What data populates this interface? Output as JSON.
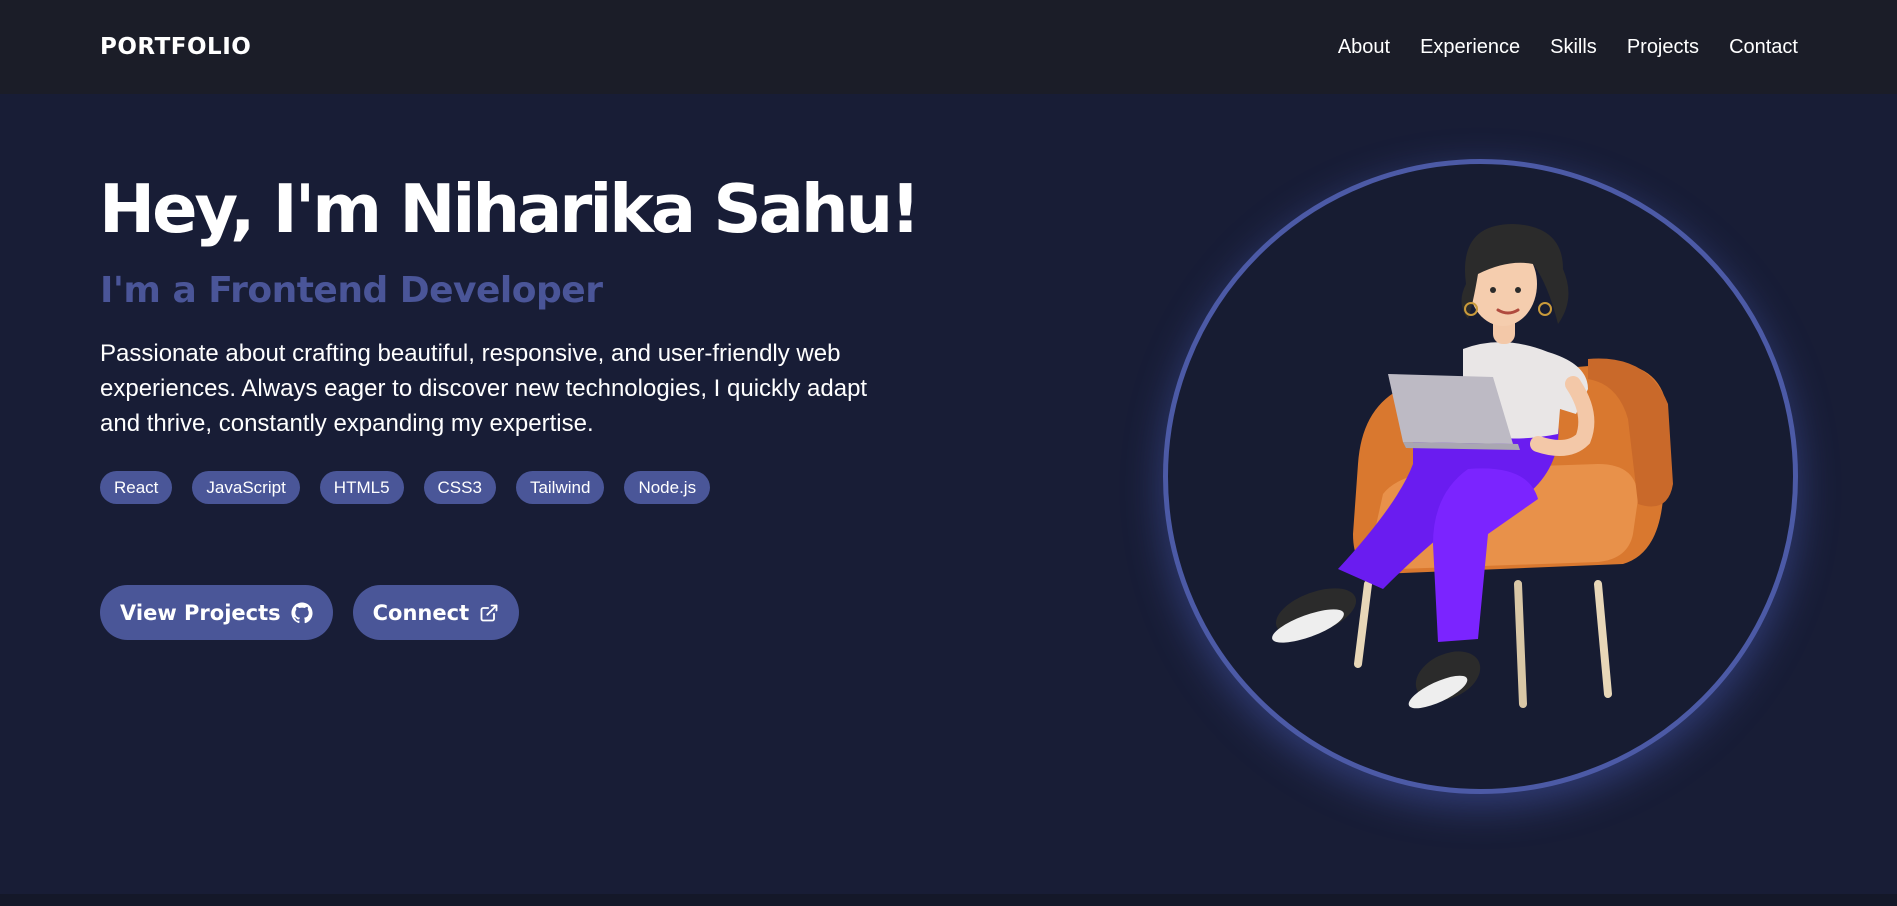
{
  "nav": {
    "brand": "PORTFOLIO",
    "links": [
      "About",
      "Experience",
      "Skills",
      "Projects",
      "Contact"
    ]
  },
  "hero": {
    "title": "Hey, I'm Niharika Sahu!",
    "subtitle": "I'm a Frontend Developer",
    "description": "Passionate about crafting beautiful, responsive, and user-friendly web experiences. Always eager to discover new technologies, I quickly adapt and thrive, constantly expanding my expertise.",
    "tags": [
      "React",
      "JavaScript",
      "HTML5",
      "CSS3",
      "Tailwind",
      "Node.js"
    ],
    "buttons": {
      "view_projects": "View Projects",
      "connect": "Connect"
    }
  },
  "icons": {
    "view_projects": "github-icon",
    "connect": "external-link-icon"
  },
  "colors": {
    "nav_bg": "#1b1d28",
    "hero_bg": "#181d36",
    "accent": "#4a5698",
    "subtitle": "#4a5598",
    "ring": "#4c5aa6"
  }
}
